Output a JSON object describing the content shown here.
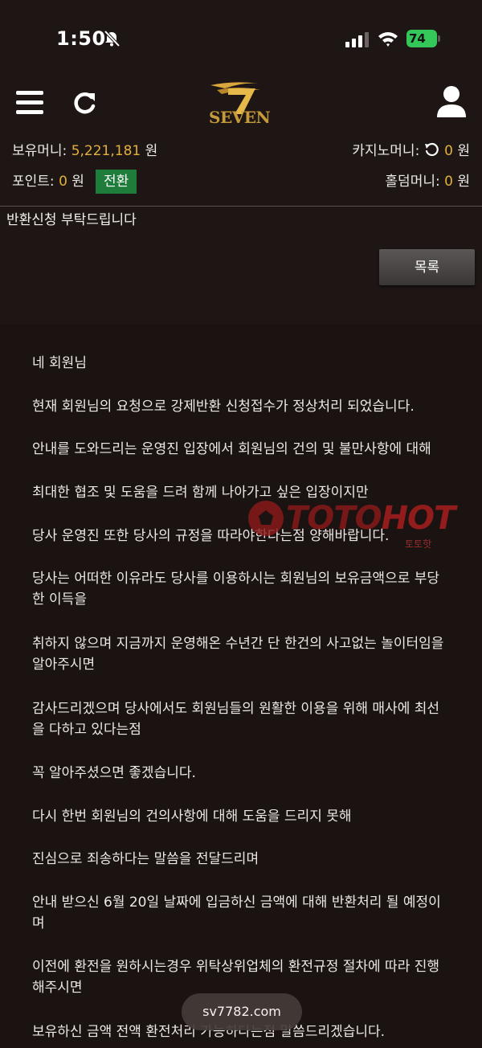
{
  "status_bar": {
    "time": "1:50",
    "battery": "74"
  },
  "header": {
    "logo_text": "SEVEN"
  },
  "account": {
    "holding_label": "보유머니:",
    "holding_value": "5,221,181",
    "casino_label": "카지노머니:",
    "casino_value": "0",
    "points_label": "포인트:",
    "points_value": "0",
    "holdem_label": "홀덤머니:",
    "holdem_value": "0",
    "currency": "원",
    "convert_button": "전환"
  },
  "post": {
    "title": "반환신청 부탁드립니다",
    "list_button": "목록",
    "paragraphs": [
      "네 회원님",
      "현재 회원님의 요청으로 강제반환 신청접수가 정상처리 되었습니다.",
      "안내를 도와드리는 운영진 입장에서 회원님의 건의 및 불만사항에 대해",
      "최대한 협조 및 도움을 드려 함께 나아가고 싶은 입장이지만",
      "당사 운영진 또한 당사의 규정을 따라야한다는점 양해바랍니다.",
      "당사는 어떠한 이유라도 당사를 이용하시는 회원님의 보유금액으로 부당한 이득을",
      "취하지 않으며 지금까지 운영해온 수년간 단 한건의 사고없는 놀이터임을 알아주시면",
      "감사드리겠으며 당사에서도 회원님들의 원활한 이용을 위해 매사에 최선을 다하고 있다는점",
      "꼭 알아주셨으면 좋겠습니다.",
      "다시 한번 회원님의 건의사항에 대해 도움을 드리지 못해",
      "진심으로 죄송하다는 말씀을 전달드리며",
      "안내 받으신 6월 20일 날짜에 입금하신 금액에 대해 반환처리 될 예정이며",
      "이전에 환전을 원하시는경우 위탁상위업체의 환전규정 절차에 따라 진행해주시면",
      "보유하신 금액 전액 환전처리 가능하다는점 말씀드리겠습니다."
    ]
  },
  "watermark": {
    "brand_a": "TOTO",
    "brand_b": "HOT",
    "sub": "토토핫"
  },
  "browser": {
    "url": "sv7782.com"
  },
  "colors": {
    "background": "#1e1615",
    "gold": "#e2b03a",
    "convert_green": "#1e7d3a"
  }
}
